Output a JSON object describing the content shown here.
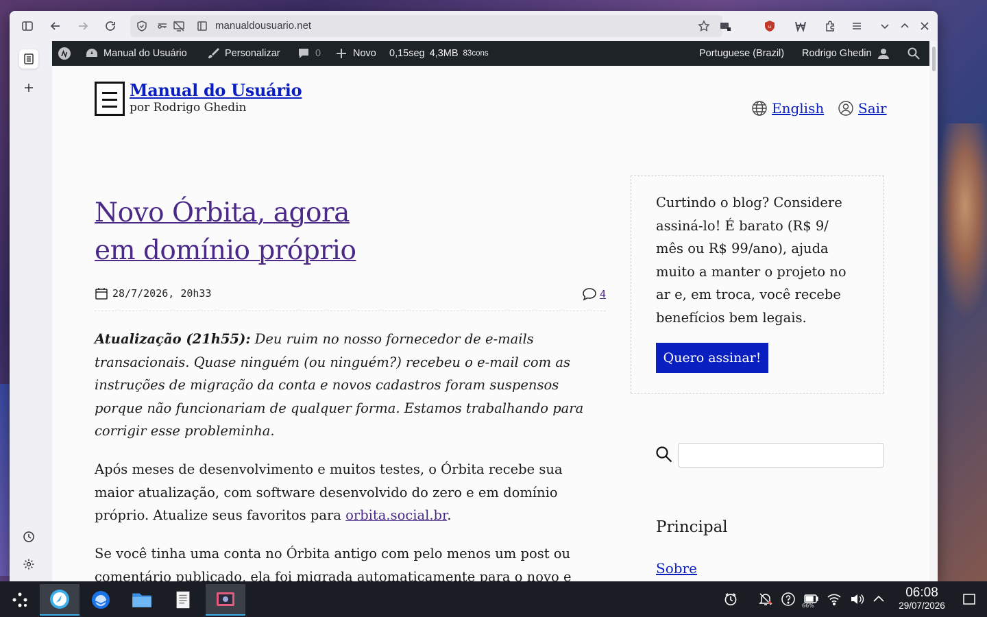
{
  "browser": {
    "url": "manualdousuario.net"
  },
  "adminbar": {
    "site_name": "Manual do Usuário",
    "customize": "Personalizar",
    "comments_count": "0",
    "new": "Novo",
    "query_time": "0,15seg",
    "memory": "4,3MB",
    "memory_unit": "",
    "queries": "83cons",
    "language": "Portuguese (Brazil)",
    "user": "Rodrigo Ghedin"
  },
  "site": {
    "title": "Manual do Usuário",
    "tagline": "por Rodrigo Ghedin",
    "lang_link": "English",
    "logout_link": "Sair"
  },
  "post": {
    "title_line1": "Novo Órbita, agora",
    "title_line2": "em domínio próprio",
    "date": "28/7/2026, 20h33",
    "comments": "4",
    "update_label": "Atualização (21h55):",
    "update_text": " Deu ruim no nosso fornecedor de e-mails transacionais. Quase ninguém (ou ninguém?) recebeu o e-mail com as instruções de migração da conta e novos cadastros foram suspensos porque não funcionariam de qualquer forma. Estamos trabalhando para corrigir esse probleminha.",
    "para2_text": "Após meses de desenvolvimento e muitos testes, o Órbita recebe sua maior atualização, com software desenvolvido do zero e em domínio próprio. Atualize seus favoritos para ",
    "para2_link": "orbita.social.br",
    "para2_end": ".",
    "para3_text": "Se você tinha uma conta no Órbita antigo com pelo menos um post ou comentário publicado, ela foi migrada automaticamente para o novo e você"
  },
  "sidebar_widgets": {
    "subscribe_text": "Curtindo o blog? Considere assiná-lo! É barato (R$ 9/ mês ou R$ 99/ano), ajuda muito a manter o projeto no ar e, em troca, você recebe benefícios bem legais.",
    "subscribe_button": "Quero assinar!",
    "menu_heading": "Principal",
    "menu_link": "Sobre"
  },
  "taskbar": {
    "time": "06:08",
    "date": "29/07/2026",
    "battery": "66%"
  }
}
